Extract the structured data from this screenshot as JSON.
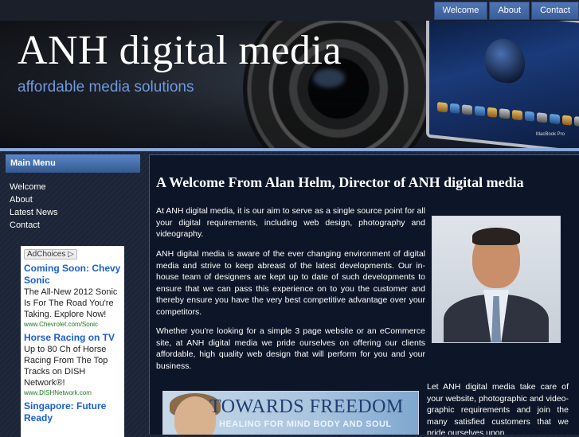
{
  "nav": {
    "items": [
      "Welcome",
      "About",
      "Contact"
    ]
  },
  "header": {
    "title": "ANH digital media",
    "tagline": "affordable media solutions",
    "laptop_label": "MacBook Pro"
  },
  "sidebar": {
    "menu_title": "Main Menu",
    "items": [
      "Welcome",
      "About",
      "Latest News",
      "Contact"
    ]
  },
  "ads": {
    "adchoices_label": "AdChoices ▷",
    "items": [
      {
        "title": "Coming Soon: Chevy Sonic",
        "desc": "The All-New 2012 Sonic Is For The Road You're Taking. Explore Now!",
        "url": "www.Chevrolet.com/Sonic"
      },
      {
        "title": "Horse Racing on TV",
        "desc": "Up to 80 Ch of Horse Racing From The Top Tracks on DISH Network®!",
        "url": "www.DISHNetwork.com"
      },
      {
        "title": "Singapore: Future Ready",
        "desc": "",
        "url": ""
      }
    ]
  },
  "main": {
    "heading": "A Welcome From Alan Helm, Director of ANH digital media",
    "paragraphs": [
      "At ANH digital media, it is our aim to serve as a single source point for all your digital requirements, including web design, photography and videography.",
      "ANH digital media is aware of the ever changing environment of digital media and strive to keep abreast of the latest developments. Our in-house team of designers are kept up to date of such developments to ensure that we can pass this experience on to you the customer and thereby ensure you have the very best competitive advantage over your competitors.",
      "Whether you're looking for a simple 3 page website or an eCommerce site, at ANH digital media we pride ourselves on offering our clients affordable, high quality web design that will perform for you and your business."
    ],
    "side_paragraph": "Let ANH digital media take care of your website, photographic and video-graphic requirements and join the many satisfied customers that we pride ourselves upon.",
    "promo": {
      "title": "TOWARDS FREEDOM",
      "subtitle": "HEALING FOR MIND BODY AND SOUL"
    }
  }
}
